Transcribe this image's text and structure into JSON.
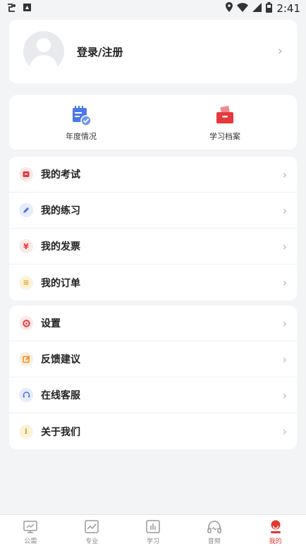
{
  "status_bar": {
    "left_icons": [
      "usb-debug-icon",
      "sim-notification-icon"
    ],
    "right_icons": [
      "location-icon",
      "wifi-icon",
      "signal-icon",
      "battery-icon"
    ],
    "time": "2:41"
  },
  "profile": {
    "login_label": "登录/注册",
    "chevron": "›"
  },
  "quick_actions": [
    {
      "label": "年度情况",
      "icon": "calendar-check-icon",
      "color": "#4a78e8"
    },
    {
      "label": "学习档案",
      "icon": "archive-box-icon",
      "color": "#e8383d"
    }
  ],
  "menu_group_1": [
    {
      "label": "我的考试",
      "icon": "exam-icon",
      "color": "#e8383d",
      "bg": "#fde8e8",
      "glyph": "■"
    },
    {
      "label": "我的练习",
      "icon": "pen-icon",
      "color": "#4a6de0",
      "bg": "#e6ecfb",
      "glyph": "✎"
    },
    {
      "label": "我的发票",
      "icon": "yuan-icon",
      "color": "#e8383d",
      "bg": "#fde8e8",
      "glyph": "¥"
    },
    {
      "label": "我的订单",
      "icon": "list-icon",
      "color": "#e3a41b",
      "bg": "#fdf3dc",
      "glyph": "≡"
    }
  ],
  "menu_group_2": [
    {
      "label": "设置",
      "icon": "gear-icon",
      "color": "#e8383d",
      "bg": "#fde8e8",
      "glyph": "⚙"
    },
    {
      "label": "反馈建议",
      "icon": "edit-icon",
      "color": "#ef8a1f",
      "bg": "#fdeedd",
      "glyph": "✎"
    },
    {
      "label": "在线客服",
      "icon": "headset-icon",
      "color": "#4a6de0",
      "bg": "#e6ecfb",
      "glyph": "◡"
    },
    {
      "label": "关于我们",
      "icon": "info-icon",
      "color": "#e3a41b",
      "bg": "#fdf3dc",
      "glyph": "i"
    }
  ],
  "row_chevron": "›",
  "bottom_nav": [
    {
      "label": "公需",
      "icon": "monitor-icon"
    },
    {
      "label": "专业",
      "icon": "chart-line-icon"
    },
    {
      "label": "学习",
      "icon": "bar-chart-icon"
    },
    {
      "label": "音频",
      "icon": "headphones-icon"
    },
    {
      "label": "我的",
      "icon": "profile-icon",
      "active": true
    }
  ],
  "colors": {
    "accent": "#e0372f",
    "background": "#f3f4f6",
    "card": "#ffffff"
  }
}
